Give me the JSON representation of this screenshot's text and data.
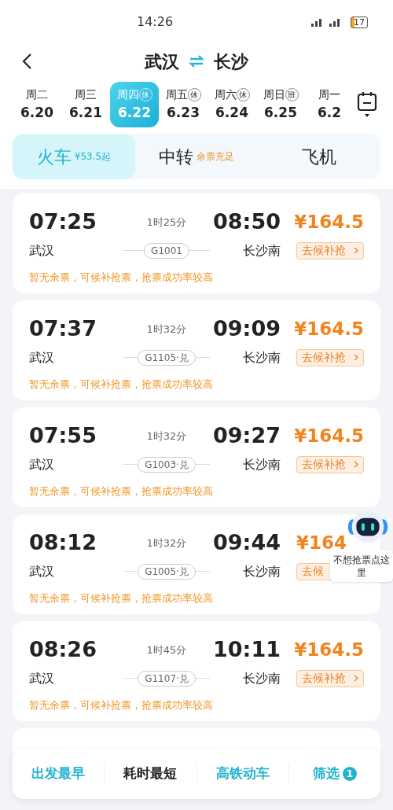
{
  "status_bar": {
    "time": "14:26",
    "battery": "17"
  },
  "header": {
    "from": "武汉",
    "to": "长沙"
  },
  "dates": [
    {
      "weekday": "周二",
      "date": "6.20",
      "selected": false
    },
    {
      "weekday": "周三",
      "date": "6.21",
      "selected": false
    },
    {
      "weekday": "周四",
      "badge": "休",
      "date": "6.22",
      "selected": true
    },
    {
      "weekday": "周五",
      "badge": "休",
      "date": "6.23",
      "selected": false
    },
    {
      "weekday": "周六",
      "badge": "休",
      "date": "6.24",
      "selected": false
    },
    {
      "weekday": "周日",
      "badge": "班",
      "date": "6.25",
      "selected": false
    },
    {
      "weekday": "周一",
      "date": "6.2",
      "selected": false
    }
  ],
  "modes": [
    {
      "label": "火车",
      "note": "¥53.5起",
      "selected": true
    },
    {
      "label": "中转",
      "note": "余票充足",
      "selected": false
    },
    {
      "label": "飞机",
      "selected": false
    }
  ],
  "trains": [
    {
      "depart": "07:25",
      "duration": "1时25分",
      "arrive": "08:50",
      "price": "¥164.5",
      "from": "武汉",
      "number": "G1001",
      "to": "长沙南",
      "action": "去候补抢",
      "notice": "暂无余票，可候补抢票，抢票成功率较高"
    },
    {
      "depart": "07:37",
      "duration": "1时32分",
      "arrive": "09:09",
      "price": "¥164.5",
      "from": "武汉",
      "number": "G1105·兑",
      "to": "长沙南",
      "action": "去候补抢",
      "notice": "暂无余票，可候补抢票，抢票成功率较高"
    },
    {
      "depart": "07:55",
      "duration": "1时32分",
      "arrive": "09:27",
      "price": "¥164.5",
      "from": "武汉",
      "number": "G1003·兑",
      "to": "长沙南",
      "action": "去候补抢",
      "notice": "暂无余票，可候补抢票，抢票成功率较高"
    },
    {
      "depart": "08:12",
      "duration": "1时32分",
      "arrive": "09:44",
      "price": "¥164",
      "from": "武汉",
      "number": "G1005·兑",
      "to": "长沙南",
      "action": "去候",
      "notice": "暂无余票，可候补抢票，抢票成功率较高"
    },
    {
      "depart": "08:26",
      "duration": "1时45分",
      "arrive": "10:11",
      "price": "¥164.5",
      "from": "武汉",
      "number": "G1107·兑",
      "to": "长沙南",
      "action": "去候补抢",
      "notice": "暂无余票，可候补抢票，抢票成功率较高"
    }
  ],
  "assistant": {
    "label": "不想抢票点这里"
  },
  "sort_bar": [
    {
      "label": "出发最早",
      "selected": true
    },
    {
      "label": "耗时最短",
      "selected": false
    },
    {
      "label": "高铁动车",
      "selected": true
    },
    {
      "label": "筛选",
      "count": "1",
      "selected": true
    }
  ]
}
